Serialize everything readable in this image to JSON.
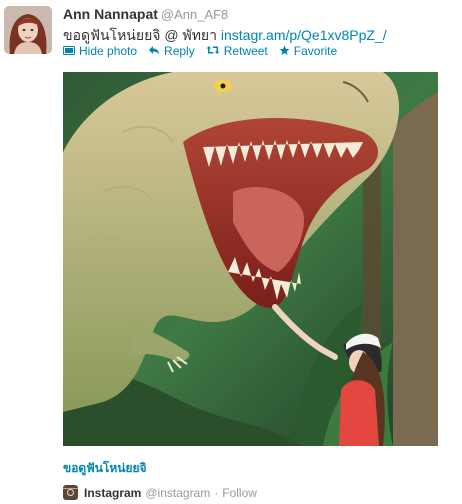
{
  "tweet": {
    "author_name": "Ann Nannapat",
    "author_handle": "@Ann_AF8",
    "text": "ขอดูฟันโหน่ยยจิ @ พัทยา ",
    "link": "instagr.am/p/Qe1xv8PpZ_/",
    "actions": {
      "hide_photo": "Hide photo",
      "reply": "Reply",
      "retweet": "Retweet",
      "favorite": "Favorite"
    }
  },
  "media": {
    "caption": "ขอดูฟันโหน่ยยจิ",
    "source_name": "Instagram",
    "source_handle": "@instagram",
    "separator": "·",
    "follow_label": "Follow"
  },
  "icons": {
    "hide_photo": "photo-icon",
    "reply": "reply-arrow-icon",
    "retweet": "retweet-icon",
    "favorite": "star-icon",
    "source": "instagram-icon"
  },
  "colors": {
    "link": "#0084b4",
    "muted": "#999999",
    "text": "#333333"
  }
}
